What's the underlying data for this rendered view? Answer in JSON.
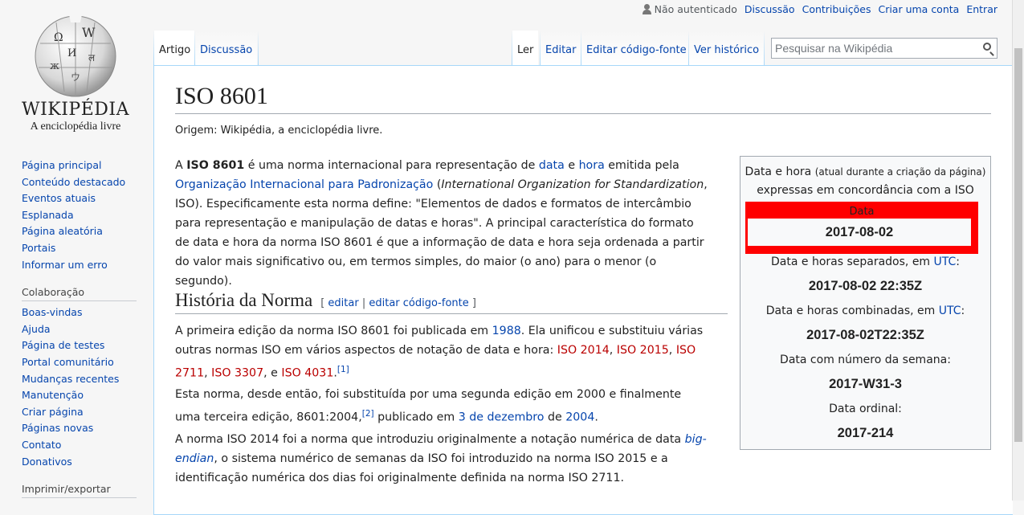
{
  "personal": {
    "not_logged": "Não autenticado",
    "discussion": "Discussão",
    "contributions": "Contribuições",
    "create_account": "Criar uma conta",
    "login": "Entrar"
  },
  "logo": {
    "wordmark": "WIKIPÉDIA",
    "tagline": "A enciclopédia livre"
  },
  "sidebar": {
    "nav": [
      "Página principal",
      "Conteúdo destacado",
      "Eventos atuais",
      "Esplanada",
      "Página aleatória",
      "Portais",
      "Informar um erro"
    ],
    "collab_heading": "Colaboração",
    "collab": [
      "Boas-vindas",
      "Ajuda",
      "Página de testes",
      "Portal comunitário",
      "Mudanças recentes",
      "Manutenção",
      "Criar página",
      "Páginas novas",
      "Contato",
      "Donativos"
    ],
    "print_heading": "Imprimir/exportar"
  },
  "tabs": {
    "article": "Artigo",
    "talk": "Discussão",
    "read": "Ler",
    "edit": "Editar",
    "edit_source": "Editar código-fonte",
    "history": "Ver histórico"
  },
  "search": {
    "placeholder": "Pesquisar na Wikipédia"
  },
  "page": {
    "title": "ISO 8601",
    "site_sub": "Origem: Wikipédia, a enciclopédia livre.",
    "intro": {
      "p1": "A ",
      "bold": "ISO 8601",
      "p2": " é uma norma internacional para representação de ",
      "data": "data",
      "e": " e ",
      "hora": "hora",
      "p3": " emitida pela ",
      "org": "Organização Internacional para Padronização",
      "p4": " (",
      "org_en": "International Organization for Standardization",
      "p5": ", ISO). Especificamente esta norma define: \"Elementos de dados e formatos de intercâmbio para representação e manipulação de datas e horas\". A principal característica do formato de data e hora da norma ISO 8601 é que a informação de data e hora seja ordenada a partir do valor mais significativo ou, em termos simples, do maior (o ano) para o menor (o segundo)."
    },
    "section": {
      "title": "História da Norma",
      "bracket_open": "[",
      "edit": "editar",
      "sep": "|",
      "edit_source": "editar código-fonte",
      "bracket_close": "]"
    },
    "para2": {
      "a": "A primeira edição da norma ISO 8601 foi publicada em ",
      "year": "1988",
      "b": ". Ela unificou e substituiu várias outras normas ISO em vários aspectos de notação de data e hora: ",
      "iso2014": "ISO 2014",
      "c1": ", ",
      "iso2015": "ISO 2015",
      "c2": ", ",
      "iso2711": "ISO 2711",
      "c3": ", ",
      "iso3307": "ISO 3307",
      "c4": ", e ",
      "iso4031": "ISO 4031",
      "c5": ".",
      "ref1": "[1]"
    },
    "para3": {
      "a": "Esta norma, desde então, foi substituída por uma segunda edição em 2000 e finalmente uma terceira edição, 8601:2004,",
      "ref2": "[2]",
      "b": " publicado em ",
      "date": "3 de dezembro",
      "c": " de ",
      "year": "2004",
      "d": "."
    },
    "para4": {
      "a": "A norma ISO 2014 foi a norma que introduziu originalmente a notação numérica de data ",
      "bigendian": "big-endian",
      "b": ", o sistema numérico de semanas da ISO foi introduzido na norma ISO 2015 e a identificação numérica dos dias foi originalmente definida na norma ISO 2711."
    }
  },
  "infobox": {
    "cap_a": "Data e hora ",
    "cap_small": "(atual durante a criação da página)",
    "cap_b": "expressas em concordância com a ISO 8601:",
    "hl_label": "Data",
    "date": "2017-08-02",
    "sep_label": "Data e horas separados, em ",
    "sep_val": "2017-08-02 22:35Z",
    "comb_label": "Data e horas combinadas, em ",
    "comb_val": "2017-08-02T22:35Z",
    "utc": "UTC",
    "colon": ":",
    "week_label": "Data com número da semana:",
    "week_val": "2017-W31-3",
    "ord_label": "Data ordinal:",
    "ord_val": "2017-214"
  },
  "colors": {
    "link": "#0645ad",
    "redlink": "#ba0000",
    "highlight": "#ff0000"
  }
}
